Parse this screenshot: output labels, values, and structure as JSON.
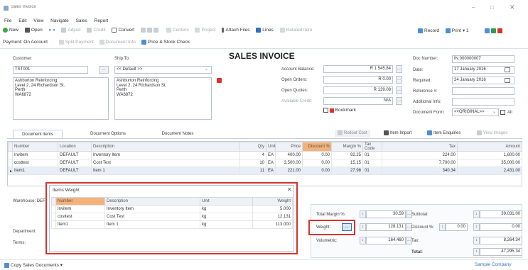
{
  "window": {
    "title": "Sales Invoice"
  },
  "menu": [
    "File",
    "Edit",
    "View",
    "Navigate",
    "Sales",
    "Report"
  ],
  "toolbar": {
    "new": "New",
    "open": "Open",
    "adjust": "Adjust",
    "credit": "Credit",
    "convert": "Convert",
    "centers": "Centers",
    "project": "Project",
    "attach": "Attach Files",
    "lines": "Lines",
    "related": "Related Item",
    "record": "Record",
    "print": "Print",
    "print_count": "1"
  },
  "toolbar2": {
    "payment_label": "Payment:",
    "payment_value": "On Account",
    "split": "Split Payment",
    "docinfo": "Document Info",
    "price": "Price & Stock Check"
  },
  "header": {
    "title": "SALES INVOICE",
    "customer_label": "Customer:",
    "customer_code": "TST001",
    "ship_label": "Ship To:",
    "ship_value": "<< Default >>",
    "customer_address": [
      "Ashburton Reinforcing",
      "Level 2, 24 Richardson St.",
      "Perth",
      "WA6872"
    ],
    "ship_address": [
      "Ashburton Reinforcing",
      "Level 2, 24 Richardson St.",
      "Perth",
      "WA6872"
    ]
  },
  "balances": {
    "account_balance_label": "Account Balance:",
    "account_balance": "R 1 545.84",
    "open_orders_label": "Open Orders:",
    "open_orders": "R 0.00",
    "open_quotes_label": "Open Quotes:",
    "open_quotes": "R 139.08",
    "available_credit_label": "Available Credit:",
    "available_credit": "N/A",
    "bookmark": "Bookmark"
  },
  "docinfo": {
    "doc_number_label": "Doc Number:",
    "doc_number": "IN.000000007",
    "date_label": "Date:",
    "date": "17 January 2016",
    "required_label": "Required:",
    "required": "24 January 2016",
    "reference_label": "Reference #:",
    "additional_label": "Additional Info:",
    "form_label": "Document Form:",
    "form_value": "<<ORIGINAL>>",
    "all_label": "All"
  },
  "tabs": [
    "Document Items",
    "Document Options",
    "Document Notes"
  ],
  "grid_actions": {
    "rollout": "Rollout Cost",
    "import": "Item Import",
    "enquiries": "Item Enquiries",
    "view_images": "View Images"
  },
  "items_grid": {
    "columns": [
      "Number",
      "Location",
      "Description",
      "Qty",
      "Unit",
      "Price",
      "Discount %",
      "Margin %",
      "Tax Code",
      "Tax",
      "Amount"
    ],
    "rows": [
      [
        "Invitem",
        "DEFAULT",
        "Inventory Item",
        "4",
        "EA",
        "400.00",
        "0.00",
        "92.25",
        "01",
        "224.00",
        "1,600.00"
      ],
      [
        "costtest",
        "DEFAULT",
        "Cost Test",
        "10",
        "EA",
        "3,500.00",
        "0.00",
        "15.15",
        "01",
        "7,700.00",
        "35,000.00"
      ],
      [
        "Item1",
        "DEFAULT",
        "Item 1",
        "11",
        "EA",
        "221.00",
        "0.00",
        "27.98",
        "01",
        "340.34",
        "2,431.00"
      ]
    ]
  },
  "warehouse_label": "Warehouse: DEF",
  "department_label": "Department:",
  "terms_label": "Terms:",
  "items_weight": {
    "title": "Items Weight",
    "columns": [
      "Number",
      "Description",
      "Unit",
      "Weight"
    ],
    "rows": [
      [
        "Invitem",
        "Inventory Item",
        "kg",
        "5.000"
      ],
      [
        "costtest",
        "Cost Test",
        "kg",
        "12.131"
      ],
      [
        "Item1",
        "Item 1",
        "kg",
        "113.000"
      ]
    ]
  },
  "totals": {
    "margin_label": "Total Margin %:",
    "margin": "30.59",
    "weight_label": "Weight:",
    "weight": "128.131",
    "volumetric_label": "Volumetric:",
    "volumetric": "164.460",
    "subtotal_label": "Subtotal:",
    "subtotal": "39,031.00",
    "discount_label": "Discount %:",
    "discount_pct": "0.00",
    "discount_amount": "0.00",
    "tax_label": "Tax:",
    "tax": "8,264.34",
    "total_label": "Total:",
    "total": "47,295.34"
  },
  "status": {
    "copy": "Copy Sales Documents",
    "company": "Sample Company"
  },
  "colors": {
    "accent": "#2f6fc4",
    "highlight": "#d9322b",
    "discount_header": "#f4b27a",
    "grid_header": "#eef1f5"
  }
}
